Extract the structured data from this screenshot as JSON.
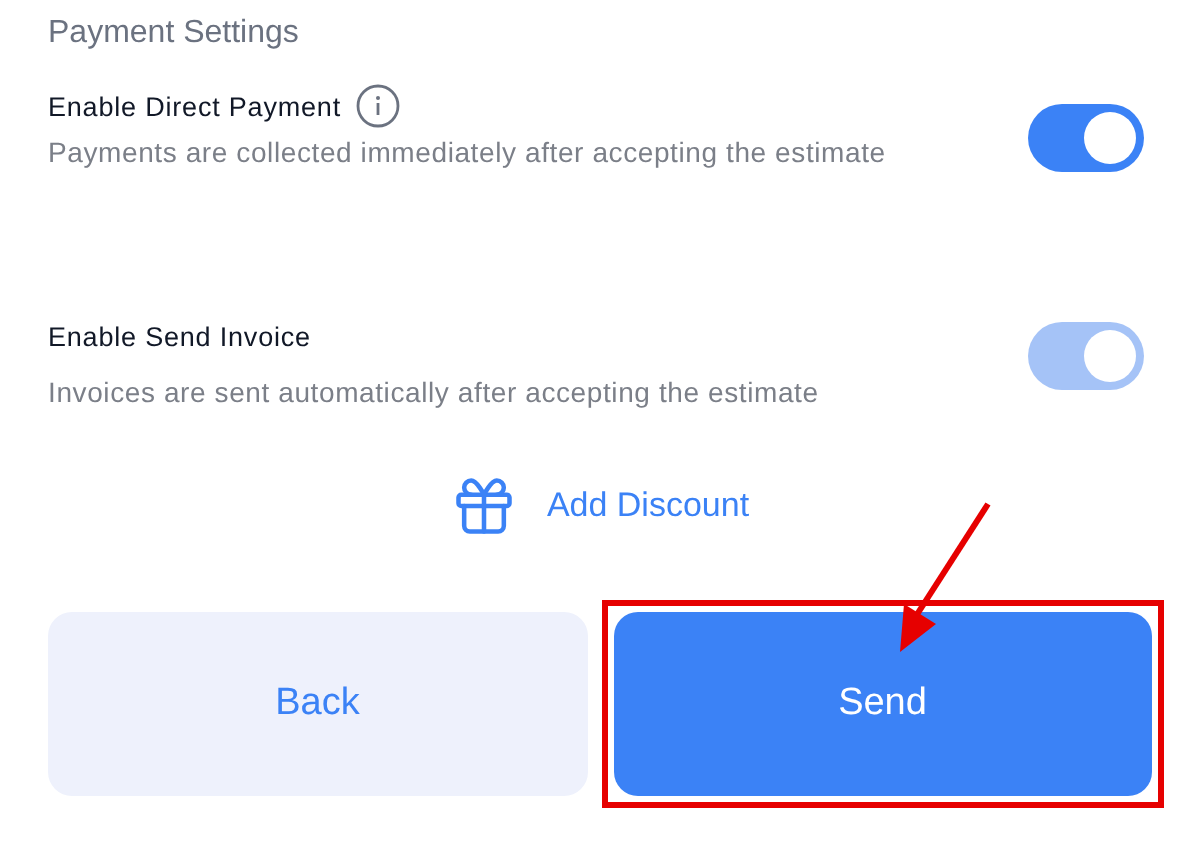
{
  "section_title": "Payment Settings",
  "settings": [
    {
      "title": "Enable Direct Payment",
      "info": true,
      "description": "Payments are collected immediately after accepting the estimate",
      "on": true,
      "disabled": false
    },
    {
      "title": "Enable Send Invoice",
      "info": false,
      "description": "Invoices are sent automatically after accepting the estimate",
      "on": true,
      "disabled": true
    }
  ],
  "discount_link": "Add Discount",
  "buttons": [
    {
      "label": "Back",
      "kind": "secondary",
      "highlighted": false
    },
    {
      "label": "Send",
      "kind": "primary",
      "highlighted": true
    }
  ]
}
